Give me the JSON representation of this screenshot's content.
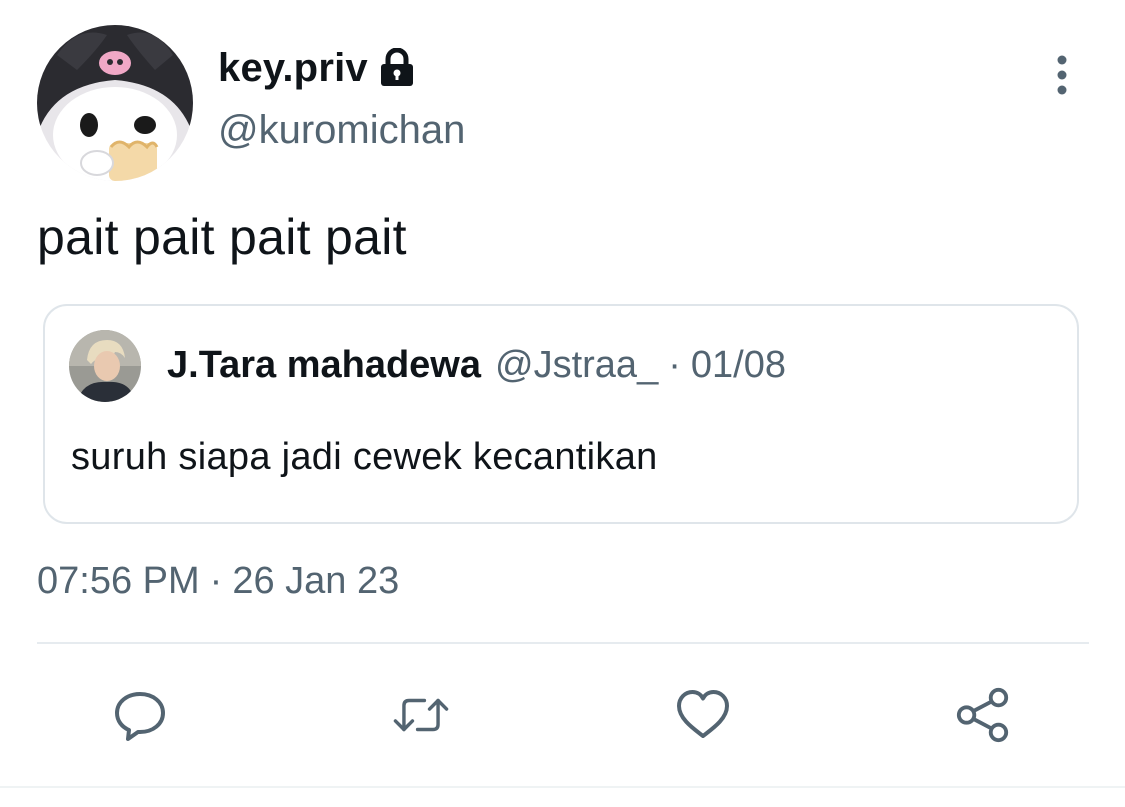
{
  "tweet": {
    "author": {
      "name": "key.priv",
      "handle": "@kuromichan",
      "avatar_icon": "kuromi-avatar",
      "protected_icon": "lock-icon"
    },
    "text": "pait pait pait pait",
    "quoted": {
      "author_name": "J.Tara mahadewa",
      "author_handle": "@Jstraa_",
      "separator": "·",
      "date": "01/08",
      "text": "suruh siapa jadi cewek kecantikan"
    },
    "timestamp": {
      "time": "07:56 PM",
      "separator": "·",
      "date": "26 Jan 23"
    }
  },
  "actions": [
    {
      "name": "reply",
      "icon": "reply-icon"
    },
    {
      "name": "retweet",
      "icon": "retweet-icon"
    },
    {
      "name": "like",
      "icon": "heart-icon"
    },
    {
      "name": "share",
      "icon": "share-icon"
    }
  ],
  "colors": {
    "text_primary": "#0f1419",
    "text_secondary": "#536471",
    "border": "#dfe5ea",
    "icon": "#536471"
  }
}
